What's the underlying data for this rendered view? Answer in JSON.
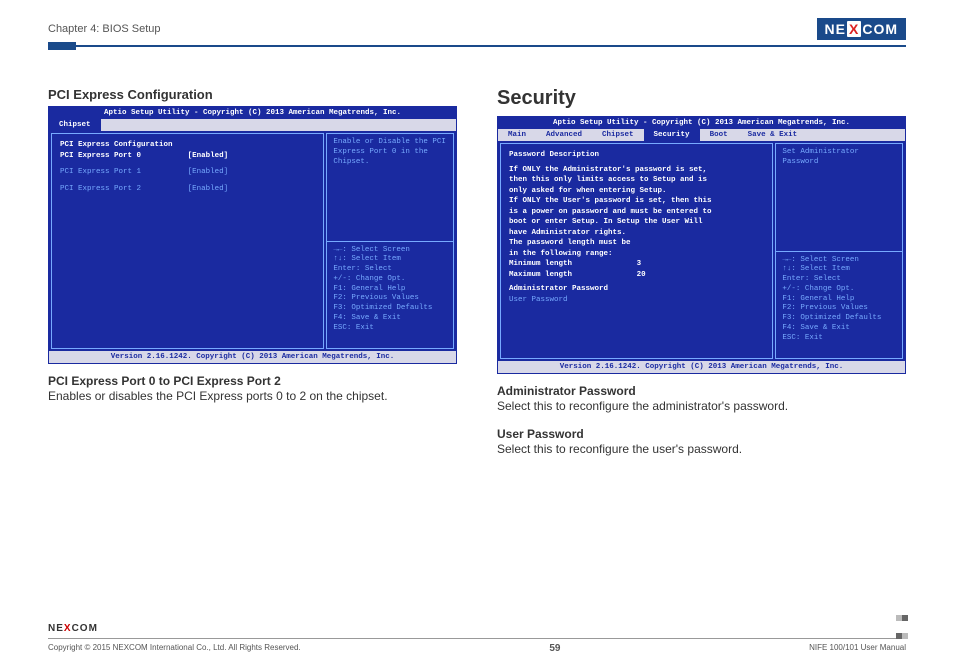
{
  "header": {
    "chapter": "Chapter 4: BIOS Setup",
    "logo_pre": "NE",
    "logo_x": "X",
    "logo_post": "COM"
  },
  "left": {
    "title": "PCI Express Configuration",
    "bios": {
      "top": "Aptio Setup Utility - Copyright (C) 2013 American Megatrends, Inc.",
      "tabs": {
        "only": "Chipset"
      },
      "main": {
        "heading": "PCI Express Configuration",
        "rows": [
          {
            "label": "PCI Express Port 0",
            "value": "[Enabled]"
          },
          {
            "label": "PCI Express Port 1",
            "value": "[Enabled]"
          },
          {
            "label": "PCI Express Port 2",
            "value": "[Enabled]"
          }
        ]
      },
      "help": "Enable or Disable the PCI Express Port 0 in the Chipset.",
      "keys": [
        "→←: Select Screen",
        "↑↓: Select Item",
        "Enter: Select",
        "+/-: Change Opt.",
        "F1: General Help",
        "F2: Previous Values",
        "F3: Optimized Defaults",
        "F4: Save & Exit",
        "ESC: Exit"
      ],
      "bottom": "Version 2.16.1242. Copyright (C) 2013 American Megatrends, Inc."
    },
    "desc_title": "PCI Express Port 0 to PCI Express Port 2",
    "desc_body": "Enables or disables the PCI Express ports 0 to 2 on the chipset."
  },
  "right": {
    "title": "Security",
    "bios": {
      "top": "Aptio Setup Utility - Copyright (C) 2013 American Megatrends, Inc.",
      "tabs": [
        "Main",
        "Advanced",
        "Chipset",
        "Security",
        "Boot",
        "Save & Exit"
      ],
      "active_tab": "Security",
      "main": {
        "heading": "Password Description",
        "body_lines": [
          "If ONLY the Administrator's password is set,",
          "then this only limits access to Setup and is",
          "only asked for when entering Setup.",
          "If ONLY the User's password is set, then this",
          "is a power on password and must be entered to",
          "boot or enter Setup. In Setup the User Will",
          "have Administrator rights.",
          "The password length must be",
          "in the following range:"
        ],
        "minmax": [
          {
            "label": "Minimum length",
            "value": "3"
          },
          {
            "label": "Maximum length",
            "value": "20"
          }
        ],
        "items": [
          "Administrator Password",
          "User Password"
        ]
      },
      "help": "Set Administrator Password",
      "keys": [
        "→←: Select Screen",
        "↑↓: Select Item",
        "Enter: Select",
        "+/-: Change Opt.",
        "F1: General Help",
        "F2: Previous Values",
        "F3: Optimized Defaults",
        "F4: Save & Exit",
        "ESC: Exit"
      ],
      "bottom": "Version 2.16.1242. Copyright (C) 2013 American Megatrends, Inc."
    },
    "desc1_title": "Administrator Password",
    "desc1_body": "Select this to reconfigure the administrator's password.",
    "desc2_title": "User Password",
    "desc2_body": "Select this to reconfigure the user's password."
  },
  "footer": {
    "logo_pre": "NE",
    "logo_x": "X",
    "logo_post": "COM",
    "copyright": "Copyright © 2015 NEXCOM International Co., Ltd. All Rights Reserved.",
    "page": "59",
    "manual": "NIFE 100/101 User Manual"
  }
}
